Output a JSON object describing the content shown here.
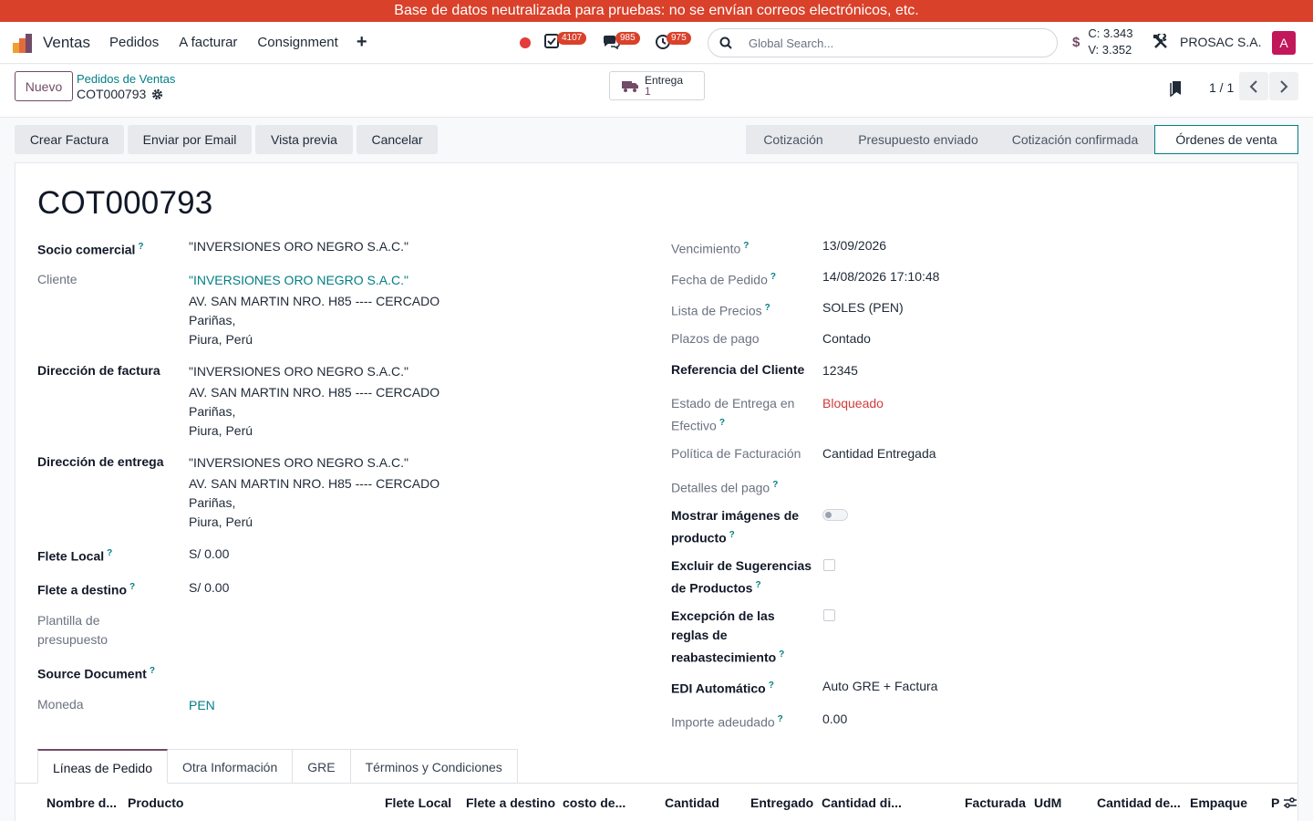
{
  "banner": "Base de datos neutralizada para pruebas: no se envían correos electrónicos, etc.",
  "nav": {
    "app_name": "Ventas",
    "menus": [
      "Pedidos",
      "A facturar",
      "Consignment"
    ],
    "plus": "+",
    "activity_badge": "4107",
    "messages_badge": "985",
    "timer_badge": "975",
    "search_placeholder": "Global Search...",
    "rate_c": "C: 3.343",
    "rate_v": "V: 3.352",
    "currency_symbol": "$",
    "company": "PROSAC S.A.",
    "avatar_letter": "A"
  },
  "control": {
    "new_label": "Nuevo",
    "breadcrumb_parent": "Pedidos de Ventas",
    "breadcrumb_current": "COT000793",
    "delivery_label": "Entrega",
    "delivery_count": "1",
    "pager": "1 / 1"
  },
  "actions": [
    "Crear Factura",
    "Enviar por Email",
    "Vista previa",
    "Cancelar"
  ],
  "stages": [
    "Cotización",
    "Presupuesto enviado",
    "Cotización confirmada",
    "Órdenes de venta"
  ],
  "stage_active": "Órdenes de venta",
  "record": {
    "title": "COT000793",
    "left": {
      "socio_label": "Socio comercial",
      "socio_value": "\"INVERSIONES ORO NEGRO S.A.C.\"",
      "cliente_label": "Cliente",
      "cliente_name": "\"INVERSIONES ORO NEGRO S.A.C.\"",
      "cliente_addr1": "AV. SAN MARTIN NRO. H85 ---- CERCADO",
      "cliente_addr2": "Pariñas,",
      "cliente_addr3": "Piura, Perú",
      "factura_label": "Dirección de factura",
      "factura_name": "\"INVERSIONES ORO NEGRO S.A.C.\"",
      "factura_addr1": "AV. SAN MARTIN NRO. H85 ---- CERCADO",
      "factura_addr2": "Pariñas,",
      "factura_addr3": "Piura, Perú",
      "entrega_label": "Dirección de entrega",
      "entrega_name": "\"INVERSIONES ORO NEGRO S.A.C.\"",
      "entrega_addr1": "AV. SAN MARTIN NRO. H85 ---- CERCADO",
      "entrega_addr2": "Pariñas,",
      "entrega_addr3": "Piura, Perú",
      "flete_local_label": "Flete Local",
      "flete_local_value": "S/ 0.00",
      "flete_destino_label": "Flete a destino",
      "flete_destino_value": "S/ 0.00",
      "plantilla_label1": "Plantilla de",
      "plantilla_label2": "presupuesto",
      "source_label": "Source Document",
      "moneda_label": "Moneda",
      "moneda_value": "PEN"
    },
    "right": {
      "vencimiento_label": "Vencimiento",
      "vencimiento_value": "13/09/2026",
      "fecha_label": "Fecha de Pedido",
      "fecha_value": "14/08/2026 17:10:48",
      "lista_label": "Lista de Precios",
      "lista_value": "SOLES (PEN)",
      "plazos_label": "Plazos de pago",
      "plazos_value": "Contado",
      "referencia_label": "Referencia del Cliente",
      "referencia_value": "12345",
      "estado_label1": "Estado de Entrega en",
      "estado_label2": "Efectivo",
      "estado_value": "Bloqueado",
      "politica_label": "Política de Facturación",
      "politica_value": "Cantidad Entregada",
      "detalles_label": "Detalles del pago",
      "mostrar_label1": "Mostrar imágenes de",
      "mostrar_label2": "producto",
      "excluir_label1": "Excluir de Sugerencias",
      "excluir_label2": "de Productos",
      "excepcion_label1": "Excepción de las",
      "excepcion_label2": "reglas de",
      "excepcion_label3": "reabastecimiento",
      "edi_label": "EDI Automático",
      "edi_value": "Auto GRE + Factura",
      "importe_label": "Importe adeudado",
      "importe_value": "0.00"
    }
  },
  "tabs": [
    "Líneas de Pedido",
    "Otra Información",
    "GRE",
    "Términos y Condiciones"
  ],
  "table_headers": [
    "Nombre d...",
    "Producto",
    "Flete Local",
    "Flete a destino",
    "costo de...",
    "Cantidad",
    "Entregado",
    "Cantidad di...",
    "Facturada",
    "UdM",
    "Cantidad de...",
    "Empaque",
    "P"
  ],
  "colors": {
    "brand": "#714b67",
    "link": "#017e84",
    "banner": "#d9412a",
    "danger": "#d13b3b"
  }
}
